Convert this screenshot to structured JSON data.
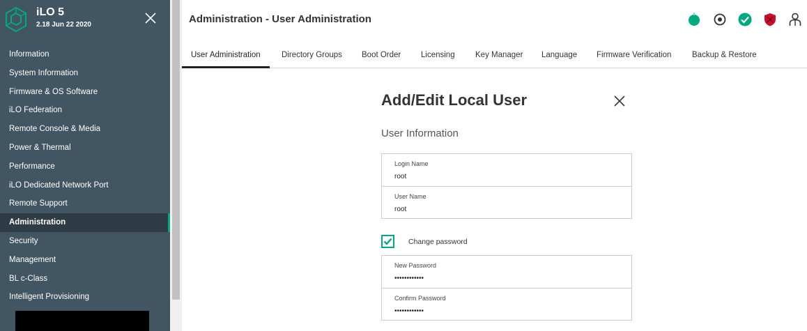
{
  "app": {
    "name": "iLO 5",
    "version": "2.18 Jun 22 2020"
  },
  "sidebar": {
    "items": [
      {
        "label": "Information"
      },
      {
        "label": "System Information"
      },
      {
        "label": "Firmware & OS Software"
      },
      {
        "label": "iLO Federation"
      },
      {
        "label": "Remote Console & Media"
      },
      {
        "label": "Power & Thermal"
      },
      {
        "label": "Performance"
      },
      {
        "label": "iLO Dedicated Network Port"
      },
      {
        "label": "Remote Support"
      },
      {
        "label": "Administration",
        "active": true
      },
      {
        "label": "Security"
      },
      {
        "label": "Management"
      },
      {
        "label": "BL c-Class"
      },
      {
        "label": "Intelligent Provisioning"
      }
    ]
  },
  "header": {
    "title": "Administration - User Administration",
    "status_icons": [
      "power-status-icon",
      "uid-indicator-icon",
      "health-ok-icon",
      "security-shield-icon",
      "user-account-icon"
    ]
  },
  "tabs": [
    {
      "label": "User Administration",
      "active": true
    },
    {
      "label": "Directory Groups"
    },
    {
      "label": "Boot Order"
    },
    {
      "label": "Licensing"
    },
    {
      "label": "Key Manager"
    },
    {
      "label": "Language"
    },
    {
      "label": "Firmware Verification"
    },
    {
      "label": "Backup & Restore"
    }
  ],
  "dialog": {
    "title": "Add/Edit Local User",
    "section": "User Information",
    "login_name": {
      "label": "Login Name",
      "value": "root"
    },
    "user_name": {
      "label": "User Name",
      "value": "root"
    },
    "change_password": {
      "label": "Change password",
      "checked": true
    },
    "new_password": {
      "label": "New Password",
      "value": "••••••••••••"
    },
    "confirm_password": {
      "label": "Confirm Password",
      "value": "••••••••••••"
    }
  },
  "colors": {
    "sidebar_bg": "#425563",
    "sidebar_active_bg": "#2f3c45",
    "accent": "#01a982",
    "shield_red": "#c8102e"
  }
}
